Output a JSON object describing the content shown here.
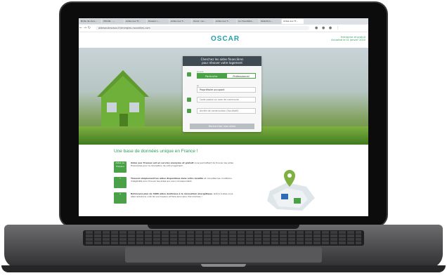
{
  "browser": {
    "tabs": [
      "Boite de réce...",
      "OSCAR - ...",
      "Aides aux Tr...",
      "Dossier i...",
      "Aides aux T...",
      "Oscar: rec...",
      "Aides aux T...",
      "La chaudière...",
      "Sélection...",
      "Aides aux Tr..."
    ],
    "active_tab": 9,
    "url": "aidesautravaux.fr/energies-nouvelles.com"
  },
  "site": {
    "logo": "OSCAR",
    "header_right_line1": "Entreprise et gratuit",
    "header_right_line2": "Actualisé le 01 janvier 2020",
    "form": {
      "title_line1": "Cherchez les aides financières",
      "title_line2": "pour rénover votre logement",
      "you_are_label": "Je suis",
      "option_particulier": "Particulier",
      "option_professionnel": "Professionnel",
      "status_label": "Je",
      "status_value": "Propriétaire occupant",
      "postal_placeholder": "Code postal ou nom de commune",
      "year_placeholder": "Année de construction (facultatif)",
      "submit_label": "Rechercher mes aides"
    },
    "section_title": "Une base de données unique en France !",
    "features": [
      {
        "icon": "Aides au Travaux",
        "text_bold": "Aides aux Travaux est un service anonyme et gratuit",
        "text": "vous permettant de trouver les aides financières pour la rénovation de votre logement."
      },
      {
        "icon": "",
        "text_bold": "Trouvez simplement les aides disponibles dans votre localité",
        "text": "et consultez les conditions d'éligibilité pour trouver les aides qui vous correspondent."
      },
      {
        "icon": "",
        "text_bold": "Retrouvez plus de 3000 aides destinées à la rénovation énergétique.",
        "text": "Grâce à elles vous allez réduire le coût de vos travaux et faire ainsi plus d'économies !"
      }
    ]
  },
  "colors": {
    "brand_teal": "#23a0a8",
    "green": "#4aa148",
    "dark": "#3f4a52"
  }
}
